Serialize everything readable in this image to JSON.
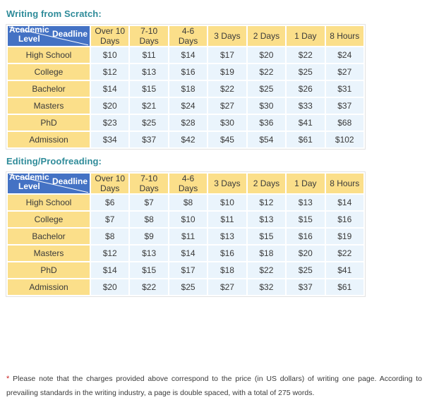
{
  "colors": {
    "heading_teal": "#2e8b99",
    "corner_blue": "#4472c4",
    "header_yellow": "#fbdf8a",
    "data_blue": "#eaf4fc",
    "text_dark": "#3a3a3a",
    "asterisk_red": "#cc2222"
  },
  "corner": {
    "deadline_label": "Deadline",
    "academic_label_line1": "Academic",
    "academic_label_line2": "Level"
  },
  "columns": [
    "Over 10 Days",
    "7-10 Days",
    "4-6 Days",
    "3 Days",
    "2 Days",
    "1 Day",
    "8 Hours"
  ],
  "tables": [
    {
      "heading": "Writing from Scratch:",
      "rows": [
        {
          "level": "High School",
          "prices": [
            "$10",
            "$11",
            "$14",
            "$17",
            "$20",
            "$22",
            "$24"
          ]
        },
        {
          "level": "College",
          "prices": [
            "$12",
            "$13",
            "$16",
            "$19",
            "$22",
            "$25",
            "$27"
          ]
        },
        {
          "level": "Bachelor",
          "prices": [
            "$14",
            "$15",
            "$18",
            "$22",
            "$25",
            "$26",
            "$31"
          ]
        },
        {
          "level": "Masters",
          "prices": [
            "$20",
            "$21",
            "$24",
            "$27",
            "$30",
            "$33",
            "$37"
          ]
        },
        {
          "level": "PhD",
          "prices": [
            "$23",
            "$25",
            "$28",
            "$30",
            "$36",
            "$41",
            "$68"
          ]
        },
        {
          "level": "Admission",
          "prices": [
            "$34",
            "$37",
            "$42",
            "$45",
            "$54",
            "$61",
            "$102"
          ]
        }
      ]
    },
    {
      "heading": "Editing/Proofreading:",
      "rows": [
        {
          "level": "High School",
          "prices": [
            "$6",
            "$7",
            "$8",
            "$10",
            "$12",
            "$13",
            "$14"
          ]
        },
        {
          "level": "College",
          "prices": [
            "$7",
            "$8",
            "$10",
            "$11",
            "$13",
            "$15",
            "$16"
          ]
        },
        {
          "level": "Bachelor",
          "prices": [
            "$8",
            "$9",
            "$11",
            "$13",
            "$15",
            "$16",
            "$19"
          ]
        },
        {
          "level": "Masters",
          "prices": [
            "$12",
            "$13",
            "$14",
            "$16",
            "$18",
            "$20",
            "$22"
          ]
        },
        {
          "level": "PhD",
          "prices": [
            "$14",
            "$15",
            "$17",
            "$18",
            "$22",
            "$25",
            "$41"
          ]
        },
        {
          "level": "Admission",
          "prices": [
            "$20",
            "$22",
            "$25",
            "$27",
            "$32",
            "$37",
            "$61"
          ]
        }
      ]
    }
  ],
  "footnote": {
    "asterisk": "*",
    "text": "Please note that the charges provided above correspond to the price (in US dollars) of writing one page. According to prevailing standards in the writing industry, a page is double spaced, with a total of 275 words."
  }
}
